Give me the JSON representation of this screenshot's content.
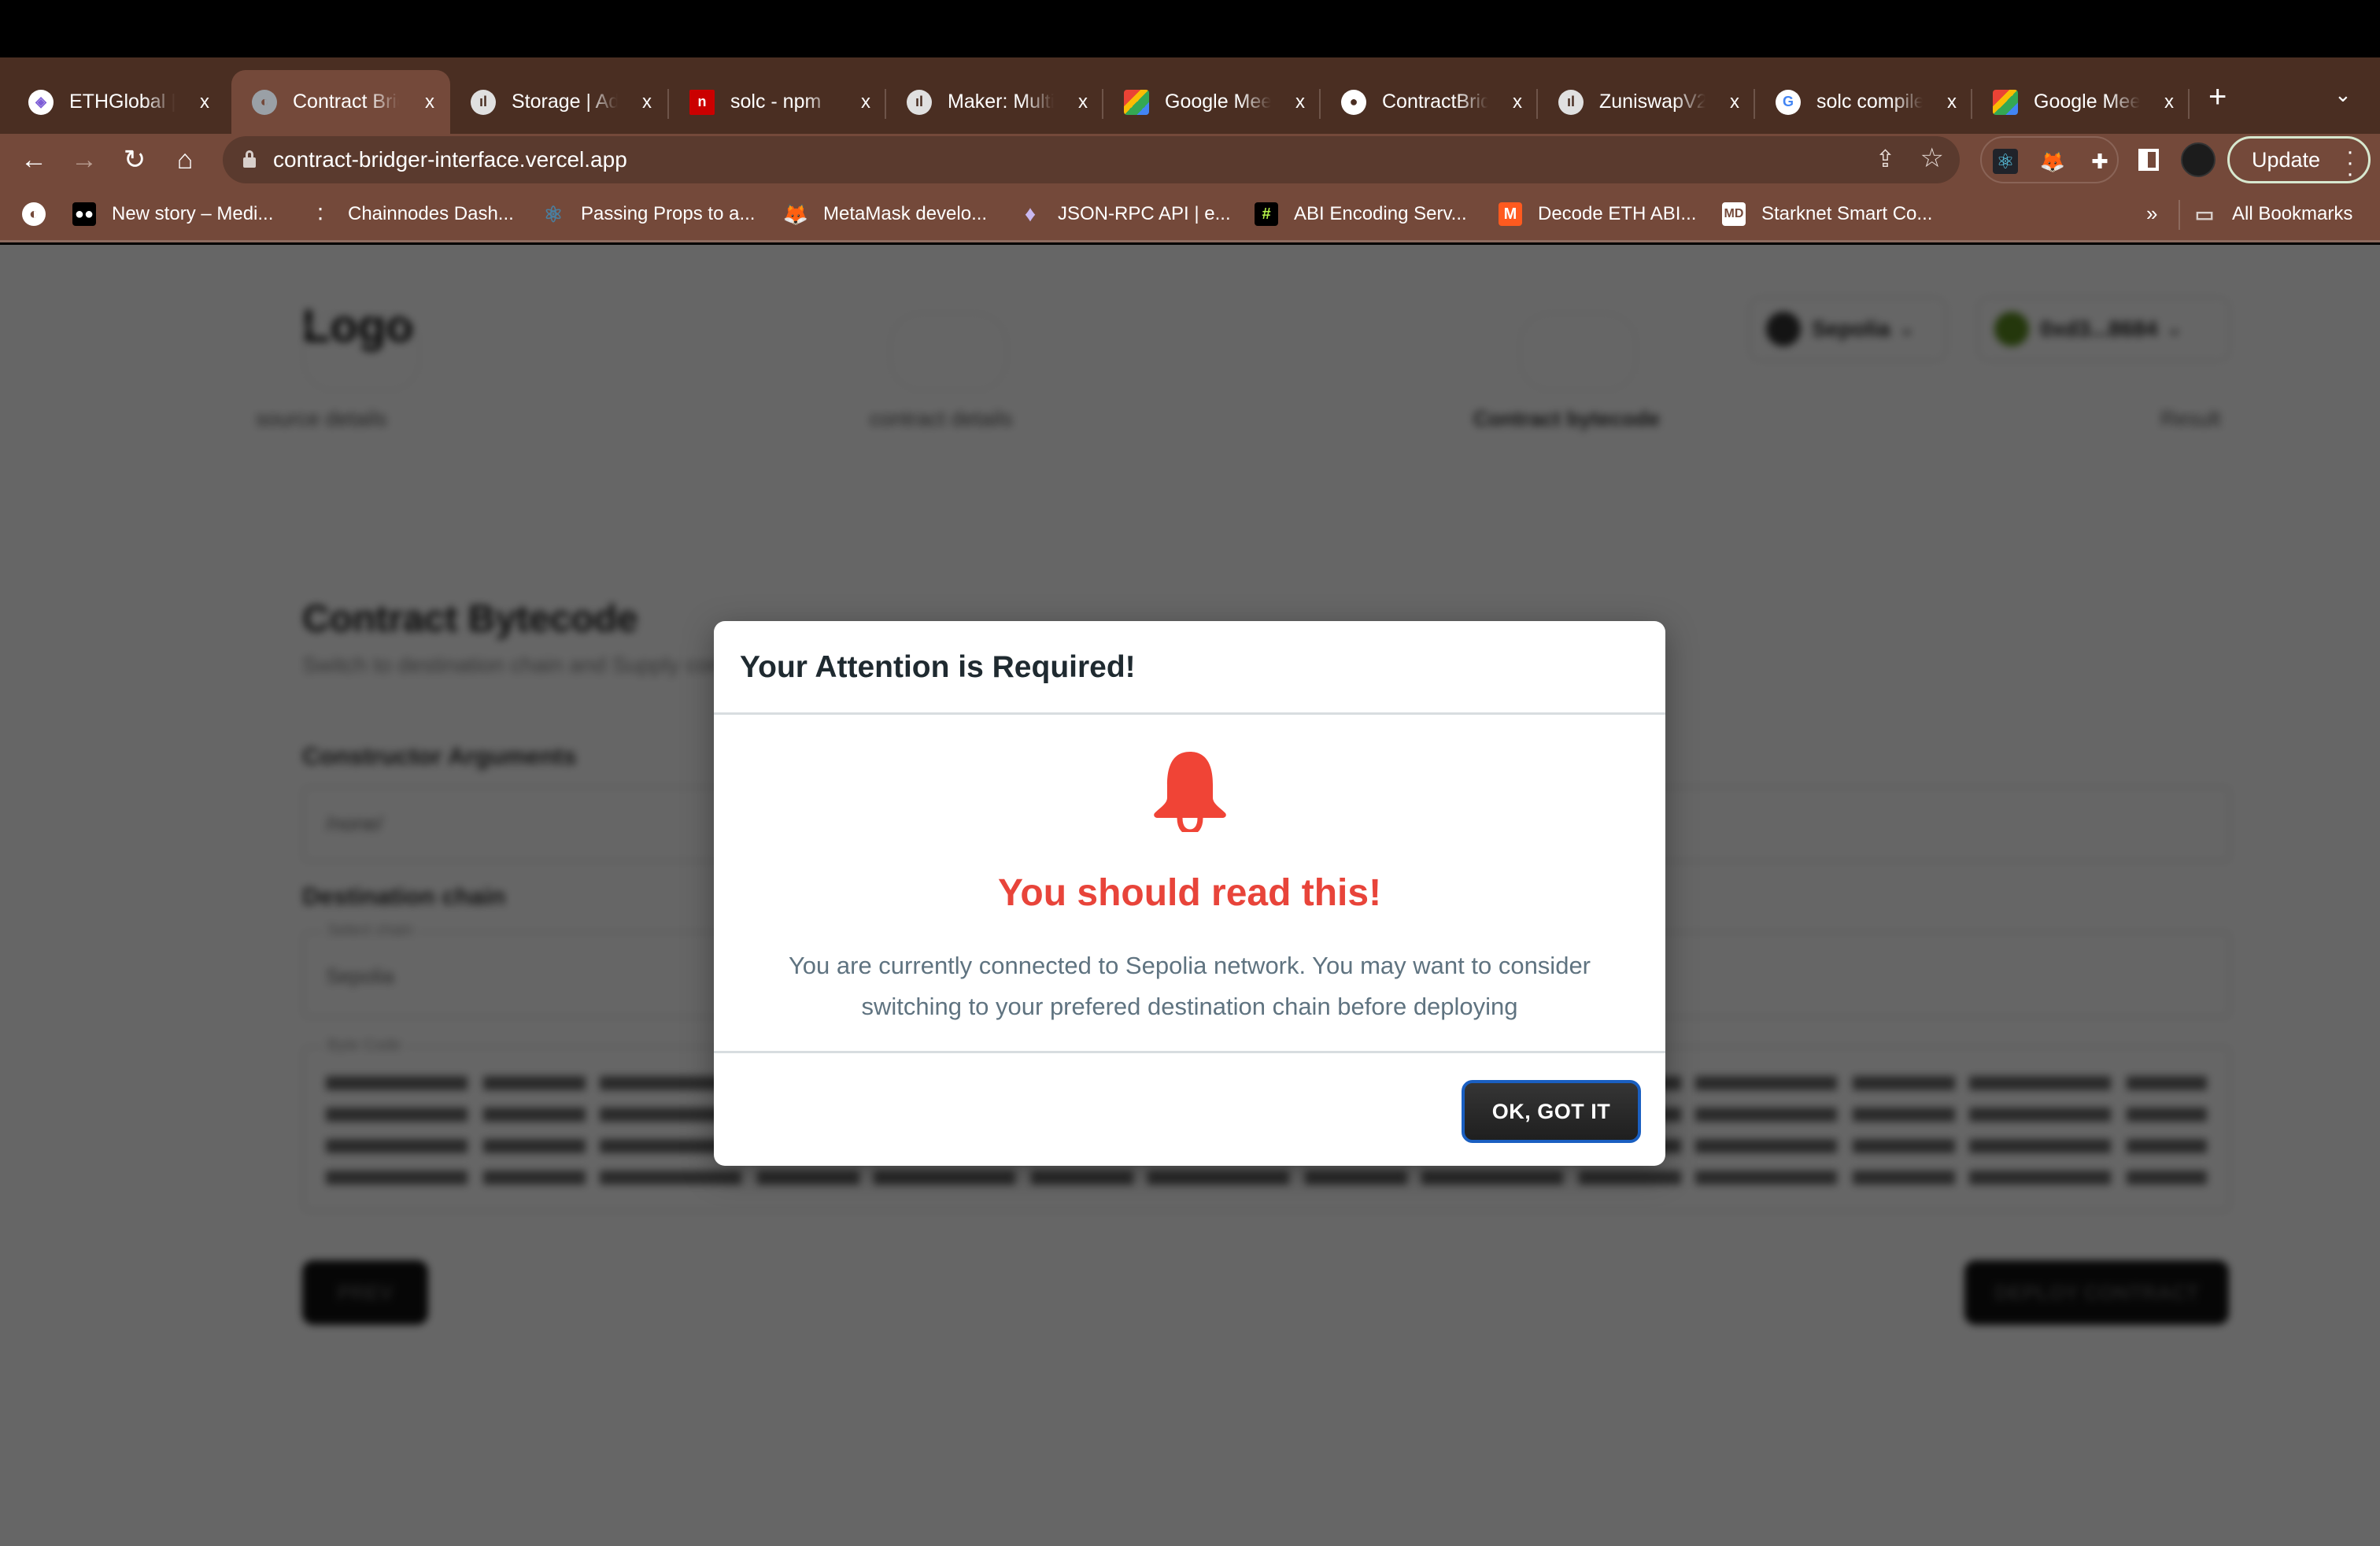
{
  "browser": {
    "tabs": [
      {
        "title": "ETHGlobal | ",
        "icon": "ethglobal-icon",
        "icon_color": "#7c5cd6",
        "active": false
      },
      {
        "title": "Contract Bridger",
        "icon": "globe-icon",
        "icon_color": "#9aa0a6",
        "active": true
      },
      {
        "title": "Storage | Ad",
        "icon": "alchemy-icon",
        "icon_color": "#d0d0d0",
        "active": false
      },
      {
        "title": "solc - npm",
        "icon": "npm-icon",
        "icon_color": "#cb0000",
        "active": false
      },
      {
        "title": "Maker: Multi",
        "icon": "alchemy-icon",
        "icon_color": "#d0d0d0",
        "active": false
      },
      {
        "title": "Google Meet",
        "icon": "google-meet-icon",
        "icon_color": "#00897b",
        "active": false
      },
      {
        "title": "ContractBridger",
        "icon": "github-icon",
        "icon_color": "#ffffff",
        "active": false
      },
      {
        "title": "ZuniswapV2",
        "icon": "alchemy-icon",
        "icon_color": "#d0d0d0",
        "active": false
      },
      {
        "title": "solc compile",
        "icon": "google-icon",
        "icon_color": "#4285f4",
        "active": false
      },
      {
        "title": "Google Meet",
        "icon": "google-meet-icon",
        "icon_color": "#00897b",
        "active": false
      }
    ],
    "close_glyph": "x",
    "new_tab_glyph": "+",
    "tab_menu_glyph": "⌄",
    "url": "contract-bridger-interface.vercel.app",
    "update_label": "Update",
    "bookmarks": [
      {
        "label": "New story – Medi...",
        "icon": "medium-icon",
        "icon_color": "#000000"
      },
      {
        "label": "Chainnodes Dash...",
        "icon": "chainnodes-icon",
        "icon_color": "#74493a"
      },
      {
        "label": "Passing Props to a...",
        "icon": "react-icon",
        "icon_color": "#4a7fa0"
      },
      {
        "label": "MetaMask develo...",
        "icon": "metamask-icon",
        "icon_color": "#e2761b"
      },
      {
        "label": "JSON-RPC API | e...",
        "icon": "ethereum-icon",
        "icon_color": "#c9b8f0"
      },
      {
        "label": "ABI Encoding Serv...",
        "icon": "hashtag-icon",
        "icon_color": "#000000"
      },
      {
        "label": "Decode ETH ABI...",
        "icon": "decoder-icon",
        "icon_color": "#ff5a1f"
      },
      {
        "label": "Starknet Smart Co...",
        "icon": "markdown-icon",
        "icon_color": "#ffffff"
      }
    ],
    "bookmarks_overflow": "»",
    "all_bookmarks_label": "All Bookmarks"
  },
  "page": {
    "logo": "Logo",
    "network_selector": "Sepolia",
    "account_selector": "0xd3...8684",
    "steps": [
      "source details",
      "contract details",
      "Contract bytecode",
      "Result"
    ],
    "section_title": "Contract Bytecode",
    "section_subtitle": "Switch to destination chain and Supply constructor arguments",
    "constructor_label": "Constructor Arguments",
    "constructor_value": "/none/",
    "destination_label": "Destination chain",
    "destination_legend": "Select chain",
    "destination_value": "Sepolia",
    "bytecode_legend": "Byte Code",
    "prev_button": "PREV",
    "deploy_button": "DEPLOY CONTRACT"
  },
  "modal": {
    "title": "Your Attention is Required!",
    "icon": "bell-icon",
    "headline": "You should read this!",
    "message": "You are currently connected to Sepolia network. You may want to consider switching to your prefered destination chain before deploying",
    "confirm_button": "OK, GOT IT",
    "accent_color": "#e8443a",
    "button_border_color": "#1a5fc1"
  }
}
